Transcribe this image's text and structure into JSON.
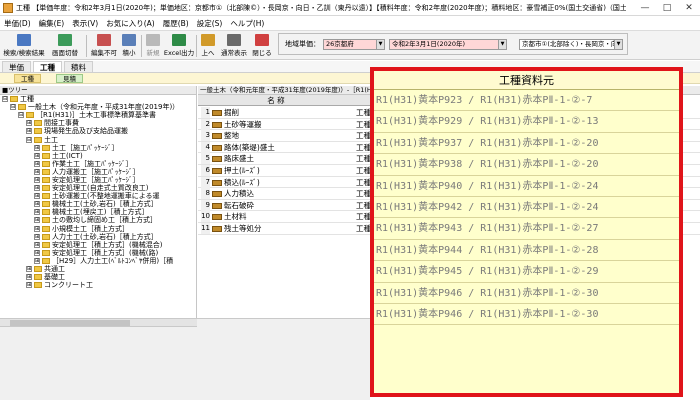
{
  "window": {
    "title": "工種 【単価年度：令和2年3月1日(2020年)；単価地区：京都市①（北部陳©）・長岡京・向日・乙訓（東丹以遠）】【積料年度：令和2年度(2020年度)；積料地区：豪雪補正0%(国土交通省)（国土交通省ブロック）】",
    "minimize": "—",
    "maximize": "□",
    "close": "✕"
  },
  "menu": [
    "単価(D)",
    "編集(E)",
    "表示(V)",
    "お気に入り(A)",
    "履歴(B)",
    "設定(S)",
    "ヘルプ(H)"
  ],
  "toolbar": {
    "buttons": [
      {
        "label": "検索/検索結果",
        "icon": "search-icon",
        "color": "#4a78c2"
      },
      {
        "label": "画面切替",
        "icon": "screen-switch-icon",
        "color": "#3c9b5a"
      },
      {
        "label": "編集不可",
        "icon": "lock-icon",
        "color": "#c75050"
      },
      {
        "label": "積小",
        "icon": "reduce-icon",
        "color": "#5a7fb8"
      },
      {
        "label": "新規",
        "icon": "new-icon",
        "color": "#b9b9b9"
      },
      {
        "label": "Excel出力",
        "icon": "excel-icon",
        "color": "#2e8b47"
      },
      {
        "label": "上へ",
        "icon": "up-icon",
        "color": "#d19a2a"
      },
      {
        "label": "通常表示",
        "icon": "view-icon",
        "color": "#6a6a6a"
      },
      {
        "label": "閉じる",
        "icon": "close-window-icon",
        "color": "#d04040"
      }
    ]
  },
  "region": {
    "label": "地域単価：",
    "year_code": "26京都府",
    "date": "令和2年3月1日(2020年)",
    "area": "京都市①(北部除く)・長岡京・向E"
  },
  "tabs": [
    "単価",
    "工種",
    "積料"
  ],
  "active_tab": "工種",
  "subtabs": [
    "工種",
    "見積"
  ],
  "tree": {
    "header": "■ツリー",
    "items": [
      {
        "label": "工種",
        "depth": 0,
        "toggle": "⊟"
      },
      {
        "label": "一般土木（令和元年度・平成31年度(2019年)）",
        "depth": 1,
        "toggle": "⊟"
      },
      {
        "label": "［R1(H31)］土木工事標準積算基準書",
        "depth": 2,
        "toggle": "⊟"
      },
      {
        "label": "間接工事費",
        "depth": 3,
        "toggle": "⊞"
      },
      {
        "label": "現場発生品及び支給品運搬",
        "depth": 3,
        "toggle": "⊞"
      },
      {
        "label": "土工",
        "depth": 3,
        "toggle": "⊟"
      },
      {
        "label": "土工［施工ﾊﾟｯｹｰｼﾞ］",
        "depth": 4,
        "toggle": "⊞"
      },
      {
        "label": "土工(ICT)",
        "depth": 4,
        "toggle": "⊞"
      },
      {
        "label": "作業土工［施工ﾊﾟｯｹｰｼﾞ］",
        "depth": 4,
        "toggle": "⊞"
      },
      {
        "label": "人力運搬工［施工ﾊﾟｯｹｰｼﾞ］",
        "depth": 4,
        "toggle": "⊞"
      },
      {
        "label": "安定処理工［施工ﾊﾟｯｹｰｼﾞ］",
        "depth": 4,
        "toggle": "⊞"
      },
      {
        "label": "安定処理工(自走式土質改良工)",
        "depth": 4,
        "toggle": "⊞"
      },
      {
        "label": "土砂運搬工(不整地運搬車による運",
        "depth": 4,
        "toggle": "⊞"
      },
      {
        "label": "機械土工(土砂,岩石)［積上方式］",
        "depth": 4,
        "toggle": "⊞"
      },
      {
        "label": "機械土工(埋戻工)［積上方式］",
        "depth": 4,
        "toggle": "⊞"
      },
      {
        "label": "土の敷均し締固め工［積上方式］",
        "depth": 4,
        "toggle": "⊞"
      },
      {
        "label": "小規模土工［積上方式］",
        "depth": 4,
        "toggle": "⊞"
      },
      {
        "label": "人力土工(土砂,岩石)［積上方式］",
        "depth": 4,
        "toggle": "⊞"
      },
      {
        "label": "安定処理工［積上方式］(機械混合)",
        "depth": 4,
        "toggle": "⊞"
      },
      {
        "label": "安定処理工［積上方式］(機械(路)",
        "depth": 4,
        "toggle": "⊞"
      },
      {
        "label": "［H29］人力土工(ﾍﾞﾙﾄｺﾝﾍﾞﾔ併用)［積",
        "depth": 4,
        "toggle": "⊞"
      },
      {
        "label": "共通工",
        "depth": 3,
        "toggle": "⊞"
      },
      {
        "label": "基礎工",
        "depth": 3,
        "toggle": "⊞"
      },
      {
        "label": "コンクリート工",
        "depth": 3,
        "toggle": "⊞"
      }
    ]
  },
  "grid": {
    "header": "一般土木（令和元年度・平成31年度(2019年度)）-［R1(H31)］土",
    "column_name": "名 称",
    "rows": [
      {
        "num": "1",
        "name": "掘削",
        "kind": "工種"
      },
      {
        "num": "2",
        "name": "土砂等運搬",
        "kind": "工種"
      },
      {
        "num": "3",
        "name": "整地",
        "kind": "工種"
      },
      {
        "num": "4",
        "name": "路体(築堤)盛土",
        "kind": "工種"
      },
      {
        "num": "5",
        "name": "路床盛土",
        "kind": "工種"
      },
      {
        "num": "6",
        "name": "押土(ﾙｰｽﾞ)",
        "kind": "工種"
      },
      {
        "num": "7",
        "name": "積込(ﾙｰｽﾞ)",
        "kind": "工種"
      },
      {
        "num": "8",
        "name": "人力積込",
        "kind": "工種"
      },
      {
        "num": "9",
        "name": "転石破砕",
        "kind": "工種"
      },
      {
        "num": "10",
        "name": "土材料",
        "kind": "工種"
      },
      {
        "num": "11",
        "name": "残土等処分",
        "kind": "工種"
      }
    ]
  },
  "overlay": {
    "header": "工種資料元",
    "rows": [
      "R1(H31)黄本P923 / R1(H31)赤本PⅡ-1-②-7",
      "R1(H31)黄本P929 / R1(H31)赤本PⅡ-1-②-13",
      "R1(H31)黄本P937 / R1(H31)赤本PⅡ-1-②-20",
      "R1(H31)黄本P938 / R1(H31)赤本PⅡ-1-②-20",
      "R1(H31)黄本P940 / R1(H31)赤本PⅡ-1-②-24",
      "R1(H31)黄本P942 / R1(H31)赤本PⅡ-1-②-24",
      "R1(H31)黄本P943 / R1(H31)赤本PⅡ-1-②-27",
      "R1(H31)黄本P944 / R1(H31)赤本PⅡ-1-②-28",
      "R1(H31)黄本P945 / R1(H31)赤本PⅡ-1-②-29",
      "R1(H31)黄本P946 / R1(H31)赤本PⅡ-1-②-30",
      "R1(H31)黄本P946 / R1(H31)赤本PⅡ-1-②-30"
    ]
  },
  "colors": {
    "highlight_border": "#e0141a",
    "overlay_bg": "#ffffcc",
    "field_highlight": "#ffd7d7"
  }
}
